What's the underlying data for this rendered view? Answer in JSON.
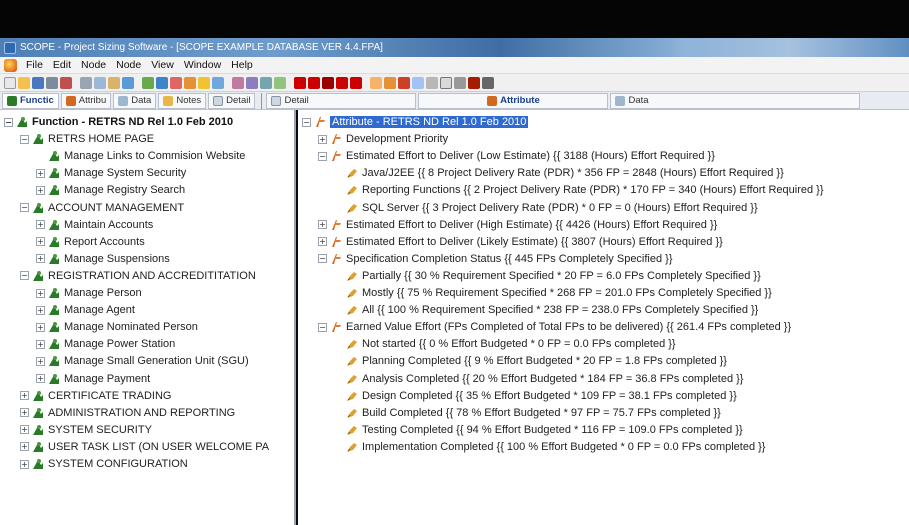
{
  "window": {
    "title": "SCOPE - Project Sizing Software - [SCOPE EXAMPLE DATABASE VER 4.4.FPA]"
  },
  "menu": {
    "items": [
      "File",
      "Edit",
      "Node",
      "Node",
      "View",
      "Window",
      "Help"
    ]
  },
  "tabs": {
    "left": [
      {
        "label": "Functic",
        "icon": "function-icon",
        "active": true
      },
      {
        "label": "Attribu",
        "icon": "attribute-icon",
        "active": false
      },
      {
        "label": "Data",
        "icon": "data-icon",
        "active": false
      },
      {
        "label": "Notes",
        "icon": "notes-icon",
        "active": false
      },
      {
        "label": "Detail",
        "icon": "detail-icon",
        "active": false
      }
    ],
    "right": [
      {
        "label": "Detail",
        "icon": "detail-icon"
      },
      {
        "label": "Attribute",
        "icon": "attribute-icon"
      },
      {
        "label": "Data",
        "icon": "data-icon"
      }
    ]
  },
  "function_tree": {
    "root": "Function - RETRS ND Rel 1.0 Feb 2010",
    "items": [
      {
        "label": "RETRS HOME PAGE",
        "depth": 1,
        "toggle": "-"
      },
      {
        "label": "Manage Links to Commision Website",
        "depth": 2,
        "toggle": ""
      },
      {
        "label": "Manage System Security",
        "depth": 2,
        "toggle": "+"
      },
      {
        "label": "Manage Registry Search",
        "depth": 2,
        "toggle": "+"
      },
      {
        "label": "ACCOUNT MANAGEMENT",
        "depth": 1,
        "toggle": "-"
      },
      {
        "label": "Maintain Accounts",
        "depth": 2,
        "toggle": "+"
      },
      {
        "label": "Report Accounts",
        "depth": 2,
        "toggle": "+"
      },
      {
        "label": "Manage Suspensions",
        "depth": 2,
        "toggle": "+"
      },
      {
        "label": "REGISTRATION AND ACCREDITITATION",
        "depth": 1,
        "toggle": "-"
      },
      {
        "label": "Manage Person",
        "depth": 2,
        "toggle": "+"
      },
      {
        "label": "Manage Agent",
        "depth": 2,
        "toggle": "+"
      },
      {
        "label": "Manage Nominated Person",
        "depth": 2,
        "toggle": "+"
      },
      {
        "label": "Manage Power Station",
        "depth": 2,
        "toggle": "+"
      },
      {
        "label": "Manage Small Generation Unit (SGU)",
        "depth": 2,
        "toggle": "+"
      },
      {
        "label": "Manage Payment",
        "depth": 2,
        "toggle": "+"
      },
      {
        "label": "CERTIFICATE TRADING",
        "depth": 1,
        "toggle": "+"
      },
      {
        "label": "ADMINISTRATION AND REPORTING",
        "depth": 1,
        "toggle": "+"
      },
      {
        "label": "SYSTEM SECURITY",
        "depth": 1,
        "toggle": "+"
      },
      {
        "label": "USER TASK LIST (ON USER WELCOME PA",
        "depth": 1,
        "toggle": "+"
      },
      {
        "label": "SYSTEM CONFIGURATION",
        "depth": 1,
        "toggle": "+"
      }
    ]
  },
  "attribute_tree": {
    "root": "Attribute - RETRS ND Rel 1.0 Feb 2010",
    "items": [
      {
        "label": "Development Priority",
        "depth": 1,
        "toggle": "+",
        "kind": "attr"
      },
      {
        "label": "Estimated Effort to Deliver (Low Estimate)    {{ 3188  (Hours)  Effort Required }}",
        "depth": 1,
        "toggle": "-",
        "kind": "attr"
      },
      {
        "label": "Java/J2EE   {{ 8 Project Delivery Rate (PDR) * 356 FP = 2848 (Hours)  Effort Required }}",
        "depth": 2,
        "toggle": "",
        "kind": "leaf"
      },
      {
        "label": "Reporting Functions    {{ 2 Project Delivery Rate (PDR) * 170 FP = 340 (Hours)  Effort Required }}",
        "depth": 2,
        "toggle": "",
        "kind": "leaf"
      },
      {
        "label": "SQL Server   {{ 3 Project Delivery Rate (PDR) * 0 FP = 0 (Hours)  Effort Required }}",
        "depth": 2,
        "toggle": "",
        "kind": "leaf"
      },
      {
        "label": "Estimated Effort to Deliver (High Estimate)   {{ 4426  (Hours)  Effort Required }}",
        "depth": 1,
        "toggle": "+",
        "kind": "attr"
      },
      {
        "label": "Estimated Effort to Deliver (Likely Estimate)   {{ 3807  (Hours)  Effort Required }}",
        "depth": 1,
        "toggle": "+",
        "kind": "attr"
      },
      {
        "label": "Specification Completion Status   {{ 445  FPs Completely Specified }}",
        "depth": 1,
        "toggle": "-",
        "kind": "attr"
      },
      {
        "label": "Partially   {{ 30 % Requirement Specified * 20 FP = 6.0 FPs Completely Specified }}",
        "depth": 2,
        "toggle": "",
        "kind": "leaf"
      },
      {
        "label": "Mostly   {{ 75 % Requirement Specified * 268 FP = 201.0 FPs Completely Specified }}",
        "depth": 2,
        "toggle": "",
        "kind": "leaf"
      },
      {
        "label": "All   {{ 100 % Requirement Specified * 238 FP = 238.0 FPs Completely Specified }}",
        "depth": 2,
        "toggle": "",
        "kind": "leaf"
      },
      {
        "label": "Earned Value Effort  (FPs Completed of Total FPs to be delivered)   {{ 261.4  FPs completed }}",
        "depth": 1,
        "toggle": "-",
        "kind": "attr"
      },
      {
        "label": "Not started   {{ 0 % Effort Budgeted * 0 FP = 0.0 FPs completed }}",
        "depth": 2,
        "toggle": "",
        "kind": "leaf"
      },
      {
        "label": "Planning Completed      {{ 9 % Effort Budgeted * 20 FP = 1.8 FPs completed }}",
        "depth": 2,
        "toggle": "",
        "kind": "leaf"
      },
      {
        "label": "Analysis Completed   {{ 20 % Effort Budgeted * 184 FP = 36.8 FPs completed }}",
        "depth": 2,
        "toggle": "",
        "kind": "leaf"
      },
      {
        "label": "Design Completed    {{ 35 % Effort Budgeted * 109 FP = 38.1 FPs completed }}",
        "depth": 2,
        "toggle": "",
        "kind": "leaf"
      },
      {
        "label": "Build Completed    {{ 78 % Effort Budgeted * 97 FP = 75.7 FPs completed }}",
        "depth": 2,
        "toggle": "",
        "kind": "leaf"
      },
      {
        "label": "Testing  Completed    {{ 94 % Effort Budgeted * 116 FP = 109.0 FPs completed }}",
        "depth": 2,
        "toggle": "",
        "kind": "leaf"
      },
      {
        "label": "Implementation Completed    {{ 100 % Effort Budgeted * 0 FP = 0.0 FPs completed }}",
        "depth": 2,
        "toggle": "",
        "kind": "leaf"
      }
    ]
  },
  "colors": {
    "selection": "#2f6ad0",
    "function_icon": "#2a7a2a",
    "attribute_icon": "#d2691e",
    "leaf_icon": "#e0a030"
  }
}
